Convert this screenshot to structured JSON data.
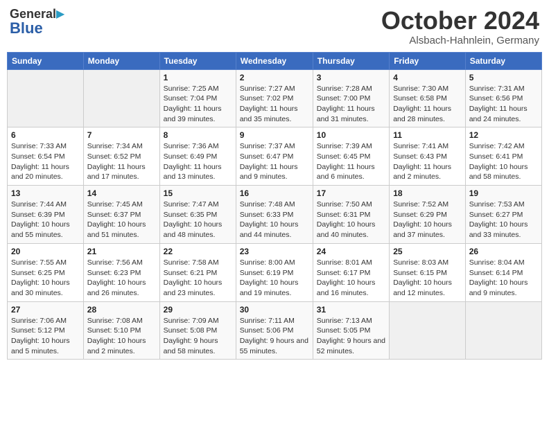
{
  "header": {
    "logo_general": "General",
    "logo_blue": "Blue",
    "title": "October 2024",
    "location": "Alsbach-Hahnlein, Germany"
  },
  "columns": [
    "Sunday",
    "Monday",
    "Tuesday",
    "Wednesday",
    "Thursday",
    "Friday",
    "Saturday"
  ],
  "weeks": [
    [
      {
        "num": "",
        "sunrise": "",
        "sunset": "",
        "daylight": ""
      },
      {
        "num": "",
        "sunrise": "",
        "sunset": "",
        "daylight": ""
      },
      {
        "num": "1",
        "sunrise": "Sunrise: 7:25 AM",
        "sunset": "Sunset: 7:04 PM",
        "daylight": "Daylight: 11 hours and 39 minutes."
      },
      {
        "num": "2",
        "sunrise": "Sunrise: 7:27 AM",
        "sunset": "Sunset: 7:02 PM",
        "daylight": "Daylight: 11 hours and 35 minutes."
      },
      {
        "num": "3",
        "sunrise": "Sunrise: 7:28 AM",
        "sunset": "Sunset: 7:00 PM",
        "daylight": "Daylight: 11 hours and 31 minutes."
      },
      {
        "num": "4",
        "sunrise": "Sunrise: 7:30 AM",
        "sunset": "Sunset: 6:58 PM",
        "daylight": "Daylight: 11 hours and 28 minutes."
      },
      {
        "num": "5",
        "sunrise": "Sunrise: 7:31 AM",
        "sunset": "Sunset: 6:56 PM",
        "daylight": "Daylight: 11 hours and 24 minutes."
      }
    ],
    [
      {
        "num": "6",
        "sunrise": "Sunrise: 7:33 AM",
        "sunset": "Sunset: 6:54 PM",
        "daylight": "Daylight: 11 hours and 20 minutes."
      },
      {
        "num": "7",
        "sunrise": "Sunrise: 7:34 AM",
        "sunset": "Sunset: 6:52 PM",
        "daylight": "Daylight: 11 hours and 17 minutes."
      },
      {
        "num": "8",
        "sunrise": "Sunrise: 7:36 AM",
        "sunset": "Sunset: 6:49 PM",
        "daylight": "Daylight: 11 hours and 13 minutes."
      },
      {
        "num": "9",
        "sunrise": "Sunrise: 7:37 AM",
        "sunset": "Sunset: 6:47 PM",
        "daylight": "Daylight: 11 hours and 9 minutes."
      },
      {
        "num": "10",
        "sunrise": "Sunrise: 7:39 AM",
        "sunset": "Sunset: 6:45 PM",
        "daylight": "Daylight: 11 hours and 6 minutes."
      },
      {
        "num": "11",
        "sunrise": "Sunrise: 7:41 AM",
        "sunset": "Sunset: 6:43 PM",
        "daylight": "Daylight: 11 hours and 2 minutes."
      },
      {
        "num": "12",
        "sunrise": "Sunrise: 7:42 AM",
        "sunset": "Sunset: 6:41 PM",
        "daylight": "Daylight: 10 hours and 58 minutes."
      }
    ],
    [
      {
        "num": "13",
        "sunrise": "Sunrise: 7:44 AM",
        "sunset": "Sunset: 6:39 PM",
        "daylight": "Daylight: 10 hours and 55 minutes."
      },
      {
        "num": "14",
        "sunrise": "Sunrise: 7:45 AM",
        "sunset": "Sunset: 6:37 PM",
        "daylight": "Daylight: 10 hours and 51 minutes."
      },
      {
        "num": "15",
        "sunrise": "Sunrise: 7:47 AM",
        "sunset": "Sunset: 6:35 PM",
        "daylight": "Daylight: 10 hours and 48 minutes."
      },
      {
        "num": "16",
        "sunrise": "Sunrise: 7:48 AM",
        "sunset": "Sunset: 6:33 PM",
        "daylight": "Daylight: 10 hours and 44 minutes."
      },
      {
        "num": "17",
        "sunrise": "Sunrise: 7:50 AM",
        "sunset": "Sunset: 6:31 PM",
        "daylight": "Daylight: 10 hours and 40 minutes."
      },
      {
        "num": "18",
        "sunrise": "Sunrise: 7:52 AM",
        "sunset": "Sunset: 6:29 PM",
        "daylight": "Daylight: 10 hours and 37 minutes."
      },
      {
        "num": "19",
        "sunrise": "Sunrise: 7:53 AM",
        "sunset": "Sunset: 6:27 PM",
        "daylight": "Daylight: 10 hours and 33 minutes."
      }
    ],
    [
      {
        "num": "20",
        "sunrise": "Sunrise: 7:55 AM",
        "sunset": "Sunset: 6:25 PM",
        "daylight": "Daylight: 10 hours and 30 minutes."
      },
      {
        "num": "21",
        "sunrise": "Sunrise: 7:56 AM",
        "sunset": "Sunset: 6:23 PM",
        "daylight": "Daylight: 10 hours and 26 minutes."
      },
      {
        "num": "22",
        "sunrise": "Sunrise: 7:58 AM",
        "sunset": "Sunset: 6:21 PM",
        "daylight": "Daylight: 10 hours and 23 minutes."
      },
      {
        "num": "23",
        "sunrise": "Sunrise: 8:00 AM",
        "sunset": "Sunset: 6:19 PM",
        "daylight": "Daylight: 10 hours and 19 minutes."
      },
      {
        "num": "24",
        "sunrise": "Sunrise: 8:01 AM",
        "sunset": "Sunset: 6:17 PM",
        "daylight": "Daylight: 10 hours and 16 minutes."
      },
      {
        "num": "25",
        "sunrise": "Sunrise: 8:03 AM",
        "sunset": "Sunset: 6:15 PM",
        "daylight": "Daylight: 10 hours and 12 minutes."
      },
      {
        "num": "26",
        "sunrise": "Sunrise: 8:04 AM",
        "sunset": "Sunset: 6:14 PM",
        "daylight": "Daylight: 10 hours and 9 minutes."
      }
    ],
    [
      {
        "num": "27",
        "sunrise": "Sunrise: 7:06 AM",
        "sunset": "Sunset: 5:12 PM",
        "daylight": "Daylight: 10 hours and 5 minutes."
      },
      {
        "num": "28",
        "sunrise": "Sunrise: 7:08 AM",
        "sunset": "Sunset: 5:10 PM",
        "daylight": "Daylight: 10 hours and 2 minutes."
      },
      {
        "num": "29",
        "sunrise": "Sunrise: 7:09 AM",
        "sunset": "Sunset: 5:08 PM",
        "daylight": "Daylight: 9 hours and 58 minutes."
      },
      {
        "num": "30",
        "sunrise": "Sunrise: 7:11 AM",
        "sunset": "Sunset: 5:06 PM",
        "daylight": "Daylight: 9 hours and 55 minutes."
      },
      {
        "num": "31",
        "sunrise": "Sunrise: 7:13 AM",
        "sunset": "Sunset: 5:05 PM",
        "daylight": "Daylight: 9 hours and 52 minutes."
      },
      {
        "num": "",
        "sunrise": "",
        "sunset": "",
        "daylight": ""
      },
      {
        "num": "",
        "sunrise": "",
        "sunset": "",
        "daylight": ""
      }
    ]
  ]
}
